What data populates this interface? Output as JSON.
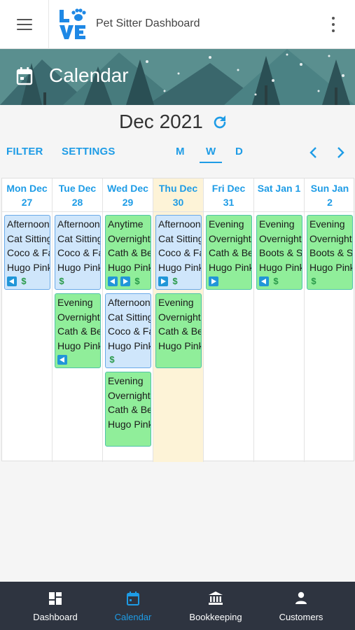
{
  "app": {
    "title": "Pet Sitter Dashboard",
    "logo_text": "LOVE"
  },
  "banner": {
    "title": "Calendar"
  },
  "month": {
    "label": "Dec 2021"
  },
  "controls": {
    "filter": "FILTER",
    "settings": "SETTINGS",
    "views": [
      "M",
      "W",
      "D"
    ],
    "active_view": "W"
  },
  "colors": {
    "accent": "#1e9ce6",
    "today": "#fdf3d7",
    "event_blue": "#cfe6fb",
    "event_green": "#90ee9a",
    "nav_bg": "#2e3440"
  },
  "days": [
    {
      "line1": "Mon Dec",
      "line2": "27",
      "today": false,
      "events": [
        {
          "color": "blue",
          "lines": [
            "Afternoon",
            "Cat Sitting",
            "Coco & Fa",
            "Hugo Pink"
          ],
          "icons": [
            "left",
            "dollar"
          ]
        }
      ]
    },
    {
      "line1": "Tue Dec",
      "line2": "28",
      "today": false,
      "events": [
        {
          "color": "blue",
          "lines": [
            "Afternoon",
            "Cat Sitting",
            "Coco & Fa",
            "Hugo Pink"
          ],
          "icons": [
            "dollar"
          ]
        },
        {
          "color": "green",
          "lines": [
            "Evening",
            "Overnight",
            "Cath & Be",
            "Hugo Pink"
          ],
          "icons": [
            "left"
          ]
        }
      ]
    },
    {
      "line1": "Wed Dec",
      "line2": "29",
      "today": false,
      "events": [
        {
          "color": "green",
          "lines": [
            "Anytime",
            "Overnight",
            "Cath & Be",
            "Hugo Pink"
          ],
          "icons": [
            "left",
            "right",
            "dollar"
          ]
        },
        {
          "color": "blue",
          "lines": [
            "Afternoon",
            "Cat Sitting",
            "Coco & Fa",
            "Hugo Pink"
          ],
          "icons": [
            "dollar"
          ]
        },
        {
          "color": "green",
          "lines": [
            "Evening",
            "Overnight",
            "Cath & Be",
            "Hugo Pink"
          ],
          "icons": []
        }
      ]
    },
    {
      "line1": "Thu Dec",
      "line2": "30",
      "today": true,
      "events": [
        {
          "color": "blue",
          "lines": [
            "Afternoon",
            "Cat Sitting",
            "Coco & Fa",
            "Hugo Pink"
          ],
          "icons": [
            "right",
            "dollar"
          ]
        },
        {
          "color": "green",
          "lines": [
            "Evening",
            "Overnight",
            "Cath & Be",
            "Hugo Pink"
          ],
          "icons": []
        }
      ]
    },
    {
      "line1": "Fri Dec",
      "line2": "31",
      "today": false,
      "events": [
        {
          "color": "green",
          "lines": [
            "Evening",
            "Overnight",
            "Cath & Be",
            "Hugo Pink"
          ],
          "icons": [
            "right"
          ]
        }
      ]
    },
    {
      "line1": "Sat Jan 1",
      "line2": "",
      "today": false,
      "events": [
        {
          "color": "green",
          "lines": [
            "Evening",
            "Overnight",
            "Boots & S",
            "Hugo Pink"
          ],
          "icons": [
            "left",
            "dollar"
          ]
        }
      ]
    },
    {
      "line1": "Sun Jan",
      "line2": "2",
      "today": false,
      "events": [
        {
          "color": "green",
          "lines": [
            "Evening",
            "Overnight",
            "Boots & S",
            "Hugo Pink"
          ],
          "icons": [
            "dollar"
          ]
        }
      ]
    }
  ],
  "bottom_nav": [
    {
      "label": "Dashboard",
      "icon": "dashboard-icon",
      "active": false
    },
    {
      "label": "Calendar",
      "icon": "calendar-icon",
      "active": true
    },
    {
      "label": "Bookkeeping",
      "icon": "bank-icon",
      "active": false
    },
    {
      "label": "Customers",
      "icon": "person-icon",
      "active": false
    }
  ]
}
